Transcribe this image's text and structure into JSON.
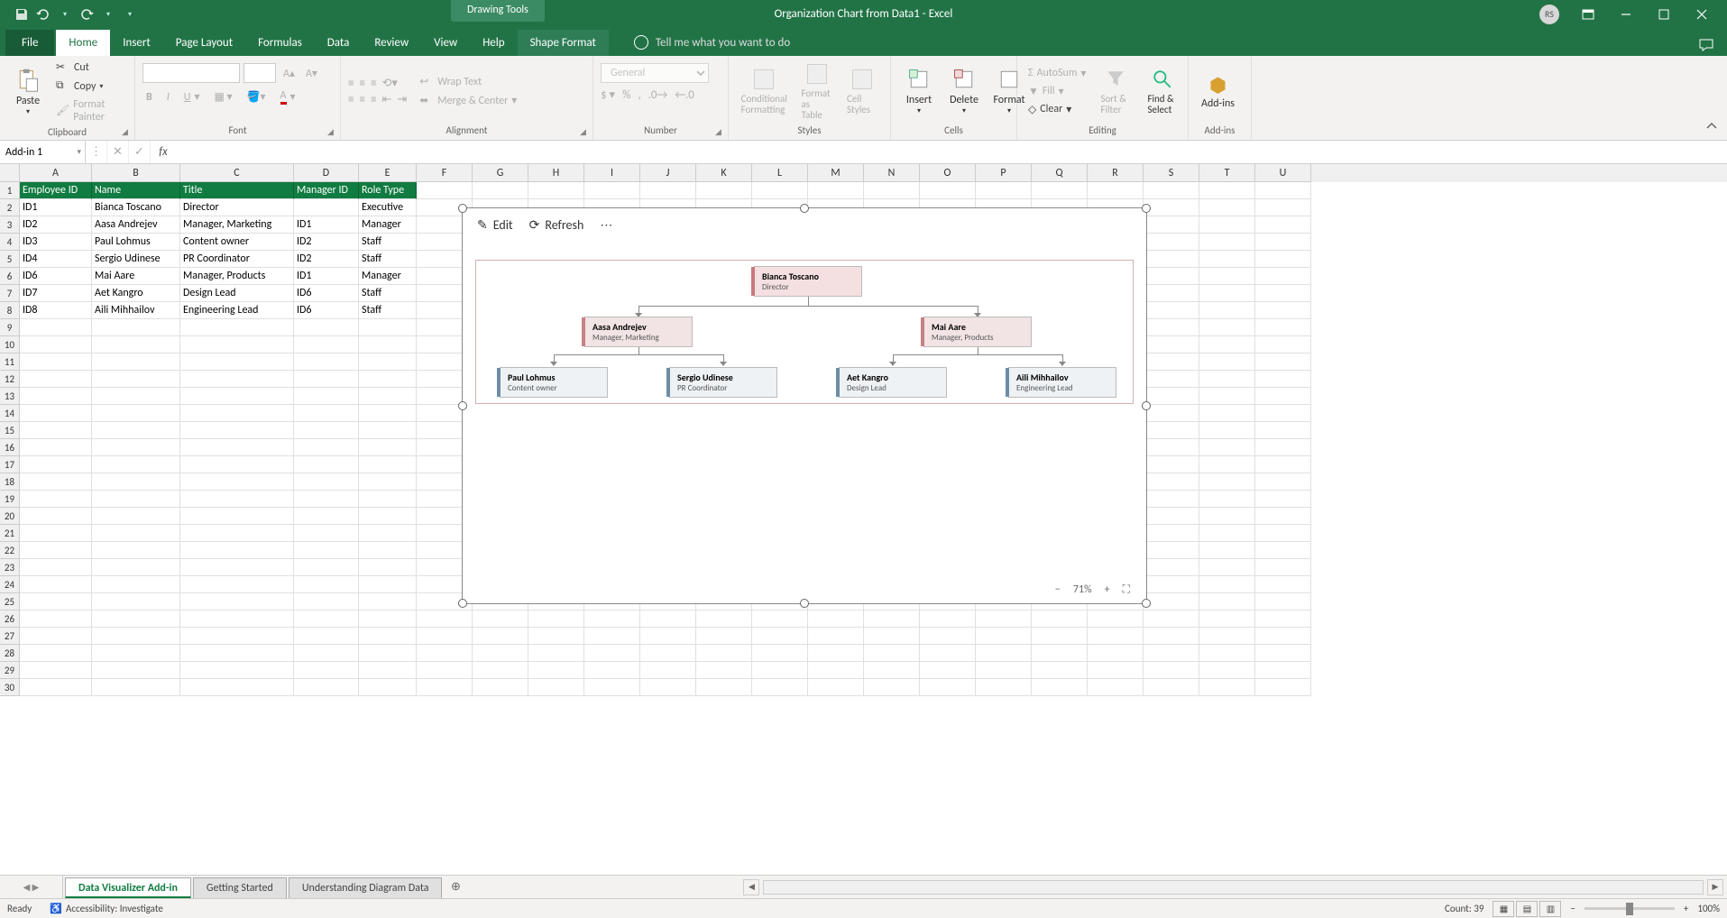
{
  "titleBar": {
    "toolContext": "Drawing Tools",
    "title": "Organization Chart from Data1 - Excel",
    "userInitials": "RS"
  },
  "ribbonTabs": {
    "file": "File",
    "home": "Home",
    "insert": "Insert",
    "pageLayout": "Page Layout",
    "formulas": "Formulas",
    "data": "Data",
    "review": "Review",
    "view": "View",
    "help": "Help",
    "shapeFormat": "Shape Format",
    "tellMe": "Tell me what you want to do"
  },
  "ribbon": {
    "clipboard": {
      "label": "Clipboard",
      "paste": "Paste",
      "cut": "Cut",
      "copy": "Copy",
      "formatPainter": "Format Painter"
    },
    "font": {
      "label": "Font"
    },
    "alignment": {
      "label": "Alignment",
      "wrapText": "Wrap Text",
      "mergeCenter": "Merge & Center"
    },
    "number": {
      "label": "Number",
      "general": "General"
    },
    "styles": {
      "label": "Styles",
      "conditional": "Conditional Formatting",
      "formatTable": "Format as Table",
      "cellStyles": "Cell Styles"
    },
    "cells": {
      "label": "Cells",
      "insert": "Insert",
      "delete": "Delete",
      "format": "Format"
    },
    "editing": {
      "label": "Editing",
      "autoSum": "AutoSum",
      "fill": "Fill",
      "clear": "Clear",
      "sortFilter": "Sort & Filter",
      "findSelect": "Find & Select"
    },
    "addins": {
      "label": "Add-ins",
      "addins": "Add-ins"
    }
  },
  "formulaBar": {
    "nameBox": "Add-in 1"
  },
  "grid": {
    "colWidths": {
      "A": 80,
      "B": 98,
      "C": 126,
      "D": 72,
      "E": 64,
      "rest": 62
    },
    "columns": [
      "A",
      "B",
      "C",
      "D",
      "E",
      "F",
      "G",
      "H",
      "I",
      "J",
      "K",
      "L",
      "M",
      "N",
      "O",
      "P",
      "Q",
      "R",
      "S",
      "T",
      "U"
    ],
    "headers": [
      "Employee ID",
      "Name",
      "Title",
      "Manager ID",
      "Role Type"
    ],
    "rows": [
      [
        "ID1",
        "Bianca Toscano",
        "Director",
        "",
        "Executive"
      ],
      [
        "ID2",
        "Aasa Andrejev",
        "Manager, Marketing",
        "ID1",
        "Manager"
      ],
      [
        "ID3",
        "Paul Lohmus",
        "Content owner",
        "ID2",
        "Staff"
      ],
      [
        "ID4",
        "Sergio Udinese",
        "PR Coordinator",
        "ID2",
        "Staff"
      ],
      [
        "ID6",
        "Mai Aare",
        "Manager, Products",
        "ID1",
        "Manager"
      ],
      [
        "ID7",
        "Aet Kangro",
        "Design Lead",
        "ID6",
        "Staff"
      ],
      [
        "ID8",
        "Aili Mihhailov",
        "Engineering Lead",
        "ID6",
        "Staff"
      ]
    ],
    "emptyRows": 22
  },
  "addin": {
    "edit": "Edit",
    "refresh": "Refresh",
    "zoom": "71%",
    "nodes": {
      "n1": {
        "name": "Bianca Toscano",
        "title": "Director"
      },
      "n2": {
        "name": "Aasa Andrejev",
        "title": "Manager, Marketing"
      },
      "n3": {
        "name": "Mai Aare",
        "title": "Manager, Products"
      },
      "n4": {
        "name": "Paul Lohmus",
        "title": "Content owner"
      },
      "n5": {
        "name": "Sergio Udinese",
        "title": "PR Coordinator"
      },
      "n6": {
        "name": "Aet Kangro",
        "title": "Design Lead"
      },
      "n7": {
        "name": "Aili Mihhailov",
        "title": "Engineering Lead"
      }
    }
  },
  "sheets": {
    "active": "Data Visualizer Add-in",
    "s2": "Getting Started",
    "s3": "Understanding Diagram Data"
  },
  "statusBar": {
    "ready": "Ready",
    "accessibility": "Accessibility: Investigate",
    "count": "Count: 39",
    "zoom": "100%"
  }
}
